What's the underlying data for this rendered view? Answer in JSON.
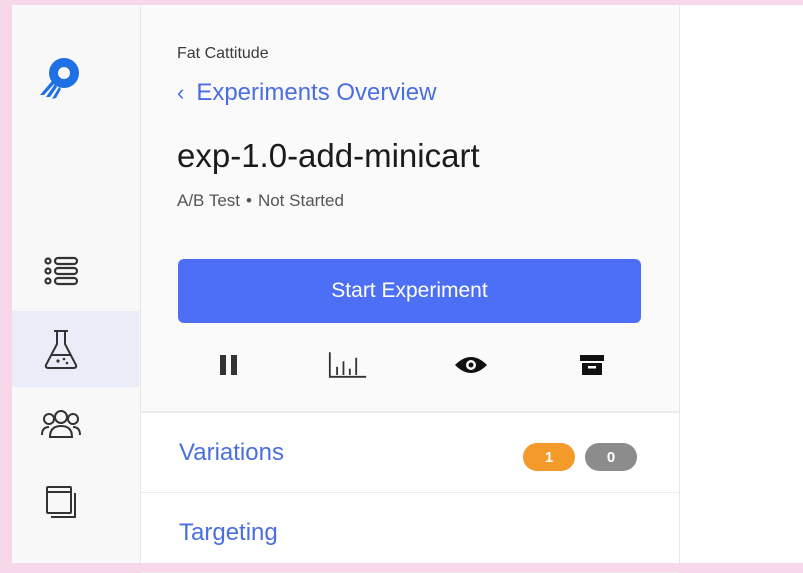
{
  "sidebar": {
    "items": [
      {
        "name": "list",
        "icon": "list-icon"
      },
      {
        "name": "experiments",
        "icon": "flask-icon",
        "active": true
      },
      {
        "name": "audiences",
        "icon": "users-icon"
      },
      {
        "name": "pages",
        "icon": "window-icon"
      }
    ],
    "logo_icon": "rocket-logo-icon"
  },
  "header": {
    "project_name": "Fat Cattitude",
    "back_link": "Experiments Overview",
    "experiment_name": "exp-1.0-add-minicart",
    "type": "A/B Test",
    "separator": "•",
    "status": "Not Started"
  },
  "actions": {
    "start_label": "Start Experiment",
    "tools": [
      {
        "icon": "pause-icon"
      },
      {
        "icon": "chart-icon"
      },
      {
        "icon": "eye-icon"
      },
      {
        "icon": "archive-icon"
      }
    ]
  },
  "sections": [
    {
      "label": "Variations",
      "badge_orange": "1",
      "badge_gray": "0"
    },
    {
      "label": "Targeting"
    }
  ],
  "colors": {
    "accent": "#4c6ff5",
    "link": "#4a6ee0",
    "badge_orange": "#f39a2a",
    "badge_gray": "#8c8c8c",
    "frame": "#f6d8ea"
  }
}
